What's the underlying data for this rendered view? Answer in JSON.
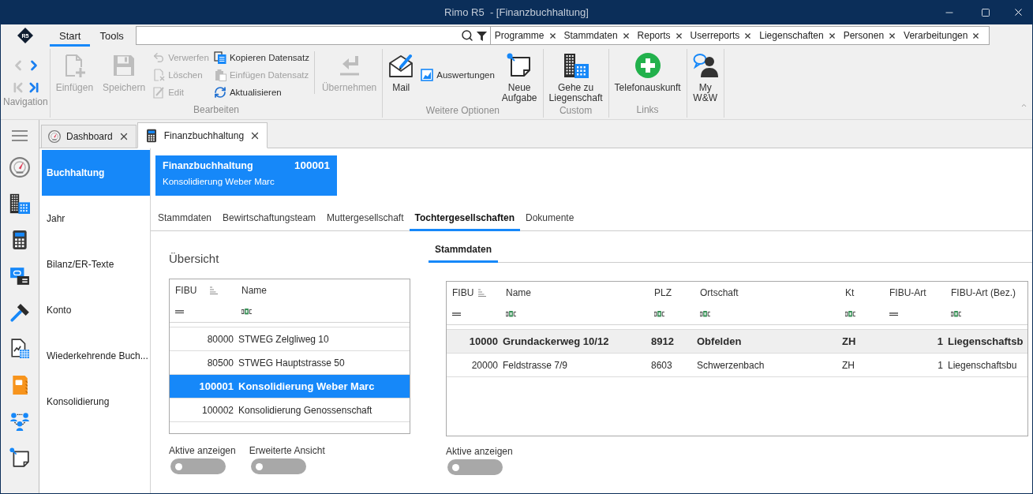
{
  "window": {
    "title": "Rimo R5  - [Finanzbuchhaltung]"
  },
  "ribbon": {
    "logo": "R5",
    "tabs": [
      {
        "label": "Start",
        "selected": true
      },
      {
        "label": "Tools",
        "selected": false
      }
    ],
    "quick_links": [
      "Programme",
      "Stammdaten",
      "Reports",
      "Userreports",
      "Liegenschaften",
      "Personen",
      "Verarbeitungen"
    ],
    "groups": [
      {
        "label": "Navigation",
        "kind": "navigation",
        "buttons": [
          {
            "disabled": true
          },
          {
            "disabled": false
          },
          {
            "disabled": true
          },
          {
            "disabled": false
          }
        ]
      },
      {
        "label": "Bearbeiten",
        "kind": "actions",
        "items": [
          {
            "kind": "large",
            "label": "Einfügen",
            "disabled": true
          },
          {
            "kind": "large",
            "label": "Speichern",
            "disabled": true
          },
          {
            "kind": "small",
            "label": "Verwerfen",
            "disabled": true
          },
          {
            "kind": "small",
            "label": "Löschen",
            "disabled": true
          },
          {
            "kind": "small",
            "label": "Edit",
            "disabled": true
          },
          {
            "kind": "small",
            "label": "Kopieren Datensatz",
            "disabled": false
          },
          {
            "kind": "small",
            "label": "Einfügen Datensatz",
            "disabled": true
          },
          {
            "kind": "small",
            "label": "Aktualisieren",
            "disabled": false
          },
          {
            "kind": "separator"
          },
          {
            "kind": "large",
            "label": "Übernehmen",
            "disabled": true
          }
        ]
      },
      {
        "label": "Weitere Optionen",
        "kind": "actions",
        "items": [
          {
            "kind": "large",
            "label": "Mail",
            "disabled": false
          },
          {
            "kind": "small",
            "label": "Auswertungen",
            "disabled": false
          },
          {
            "kind": "large",
            "label": "Neue Aufgabe",
            "disabled": false
          }
        ]
      },
      {
        "label": "Custom",
        "kind": "actions",
        "items": [
          {
            "kind": "large",
            "label": "Gehe zu Liegenschaft",
            "disabled": false
          }
        ]
      },
      {
        "label": "Links",
        "kind": "actions",
        "items": [
          {
            "kind": "large",
            "label": "Telefonauskunft",
            "disabled": false
          }
        ]
      },
      {
        "kind": "actions",
        "items": [
          {
            "kind": "large",
            "label": "My W&W",
            "disabled": false
          }
        ]
      }
    ]
  },
  "document_tabs": [
    {
      "label": "Dashboard",
      "selected": false
    },
    {
      "label": "Finanzbuchhaltung",
      "selected": true
    }
  ],
  "sidebar": {
    "items": [
      {
        "label": "Buchhaltung",
        "selected": true
      },
      {
        "label": "Jahr",
        "selected": false
      },
      {
        "label": "Bilanz/ER-Texte",
        "selected": false
      },
      {
        "label": "Konto",
        "selected": false
      },
      {
        "label": "Wiederkehrende Buch...",
        "selected": false
      },
      {
        "label": "Konsolidierung",
        "selected": false
      }
    ]
  },
  "record": {
    "title": "Finanzbuchhaltung",
    "number": "100001",
    "subtitle": "Konsolidierung Weber Marc"
  },
  "record_tabs": [
    {
      "label": "Stammdaten",
      "selected": false
    },
    {
      "label": "Bewirtschaftungsteam",
      "selected": false
    },
    {
      "label": "Muttergesellschaft",
      "selected": false
    },
    {
      "label": "Tochtergesellschaften",
      "selected": true
    },
    {
      "label": "Dokumente",
      "selected": false
    }
  ],
  "overview": {
    "title": "Übersicht",
    "table": {
      "columns": [
        {
          "label": "FIBU",
          "sorted": true,
          "kind": "number"
        },
        {
          "label": "Name",
          "sorted": false,
          "kind": "text"
        }
      ],
      "rows": [
        {
          "cells": [
            "80000",
            "STWEG Zelgliweg 10"
          ],
          "selected": false
        },
        {
          "cells": [
            "80500",
            "STWEG Hauptstrasse 50"
          ],
          "selected": false
        },
        {
          "cells": [
            "100001",
            "Konsolidierung Weber Marc"
          ],
          "selected": true
        },
        {
          "cells": [
            "100002",
            "Konsolidierung Genossenschaft"
          ],
          "selected": false
        }
      ]
    },
    "toggles": [
      {
        "label": "Aktive anzeigen",
        "on": false
      },
      {
        "label": "Erweiterte Ansicht",
        "on": false
      }
    ]
  },
  "detail": {
    "tabs": [
      {
        "label": "Stammdaten",
        "selected": true
      }
    ],
    "table": {
      "columns": [
        {
          "label": "FIBU",
          "sorted": true,
          "kind": "number"
        },
        {
          "label": "Name",
          "sorted": false,
          "kind": "text"
        },
        {
          "label": "PLZ",
          "sorted": false,
          "kind": "text"
        },
        {
          "label": "Ortschaft",
          "sorted": false,
          "kind": "text"
        },
        {
          "label": "Kt",
          "sorted": false,
          "kind": "text"
        },
        {
          "label": "FIBU-Art",
          "sorted": false,
          "kind": "number"
        },
        {
          "label": "FIBU-Art (Bez.)",
          "sorted": false,
          "kind": "text"
        }
      ],
      "rows": [
        {
          "cells": [
            "10000",
            "Grundackerweg 10/12",
            "8912",
            "Obfelden",
            "ZH",
            "1",
            "Liegenschaftsb"
          ],
          "selected": true
        },
        {
          "cells": [
            "20000",
            "Feldstrasse 7/9",
            "8603",
            "Schwerzenbach",
            "ZH",
            "1",
            "Liegenschaftsbu"
          ],
          "selected": false
        }
      ]
    },
    "toggles": [
      {
        "label": "Aktive anzeigen",
        "on": false
      }
    ]
  }
}
